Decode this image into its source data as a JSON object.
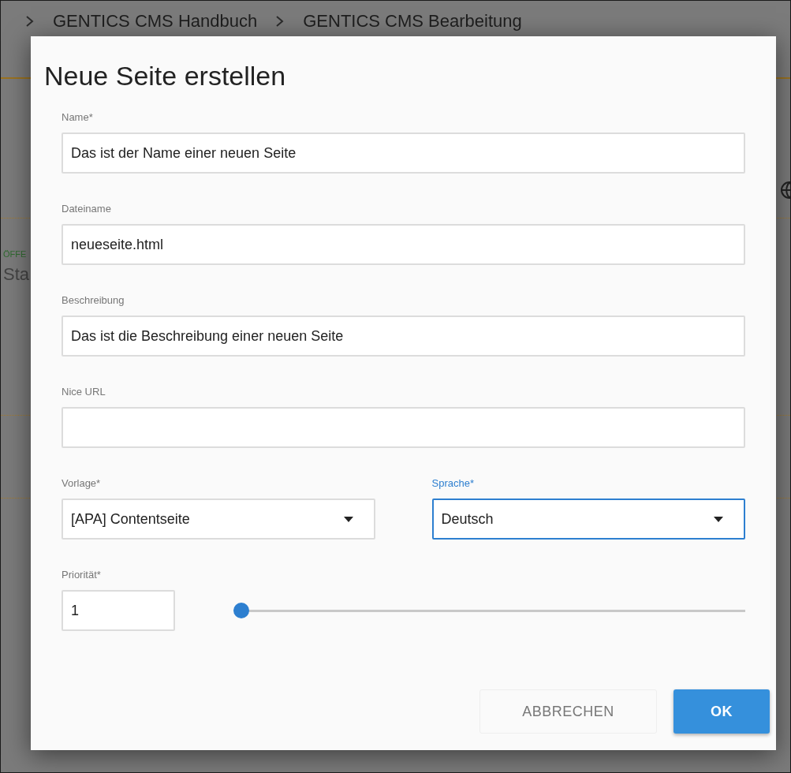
{
  "background": {
    "breadcrumb": [
      "GENTICS CMS Handbuch",
      "GENTICS CMS Bearbeitung"
    ],
    "list_texts": [
      {
        "text": "ÖFFE",
        "kind": "status"
      },
      {
        "text": "Sta",
        "kind": "name"
      }
    ]
  },
  "dialog": {
    "title": "Neue Seite erstellen",
    "fields": [
      {
        "kind": "text",
        "label": "Name*",
        "value": "Das ist der Name einer neuen Seite",
        "focused": false
      },
      {
        "kind": "text",
        "label": "Dateiname",
        "value": "neueseite.html",
        "focused": false
      },
      {
        "kind": "text",
        "label": "Beschreibung",
        "value": "Das ist die Beschreibung einer neuen Seite",
        "focused": false
      },
      {
        "kind": "text",
        "label": "Nice URL",
        "focused": false
      }
    ],
    "selects": [
      {
        "label": "Vorlage*",
        "value": "[APA] Contentseite",
        "focused": false
      },
      {
        "label": "Sprache*",
        "value": "Deutsch",
        "focused": true
      }
    ],
    "priority": {
      "label": "Priorität*",
      "value": "1",
      "level": 0
    },
    "buttons": [
      {
        "label": "ABBRECHEN",
        "kind": "secondary"
      },
      {
        "label": "OK",
        "kind": "primary"
      }
    ]
  }
}
